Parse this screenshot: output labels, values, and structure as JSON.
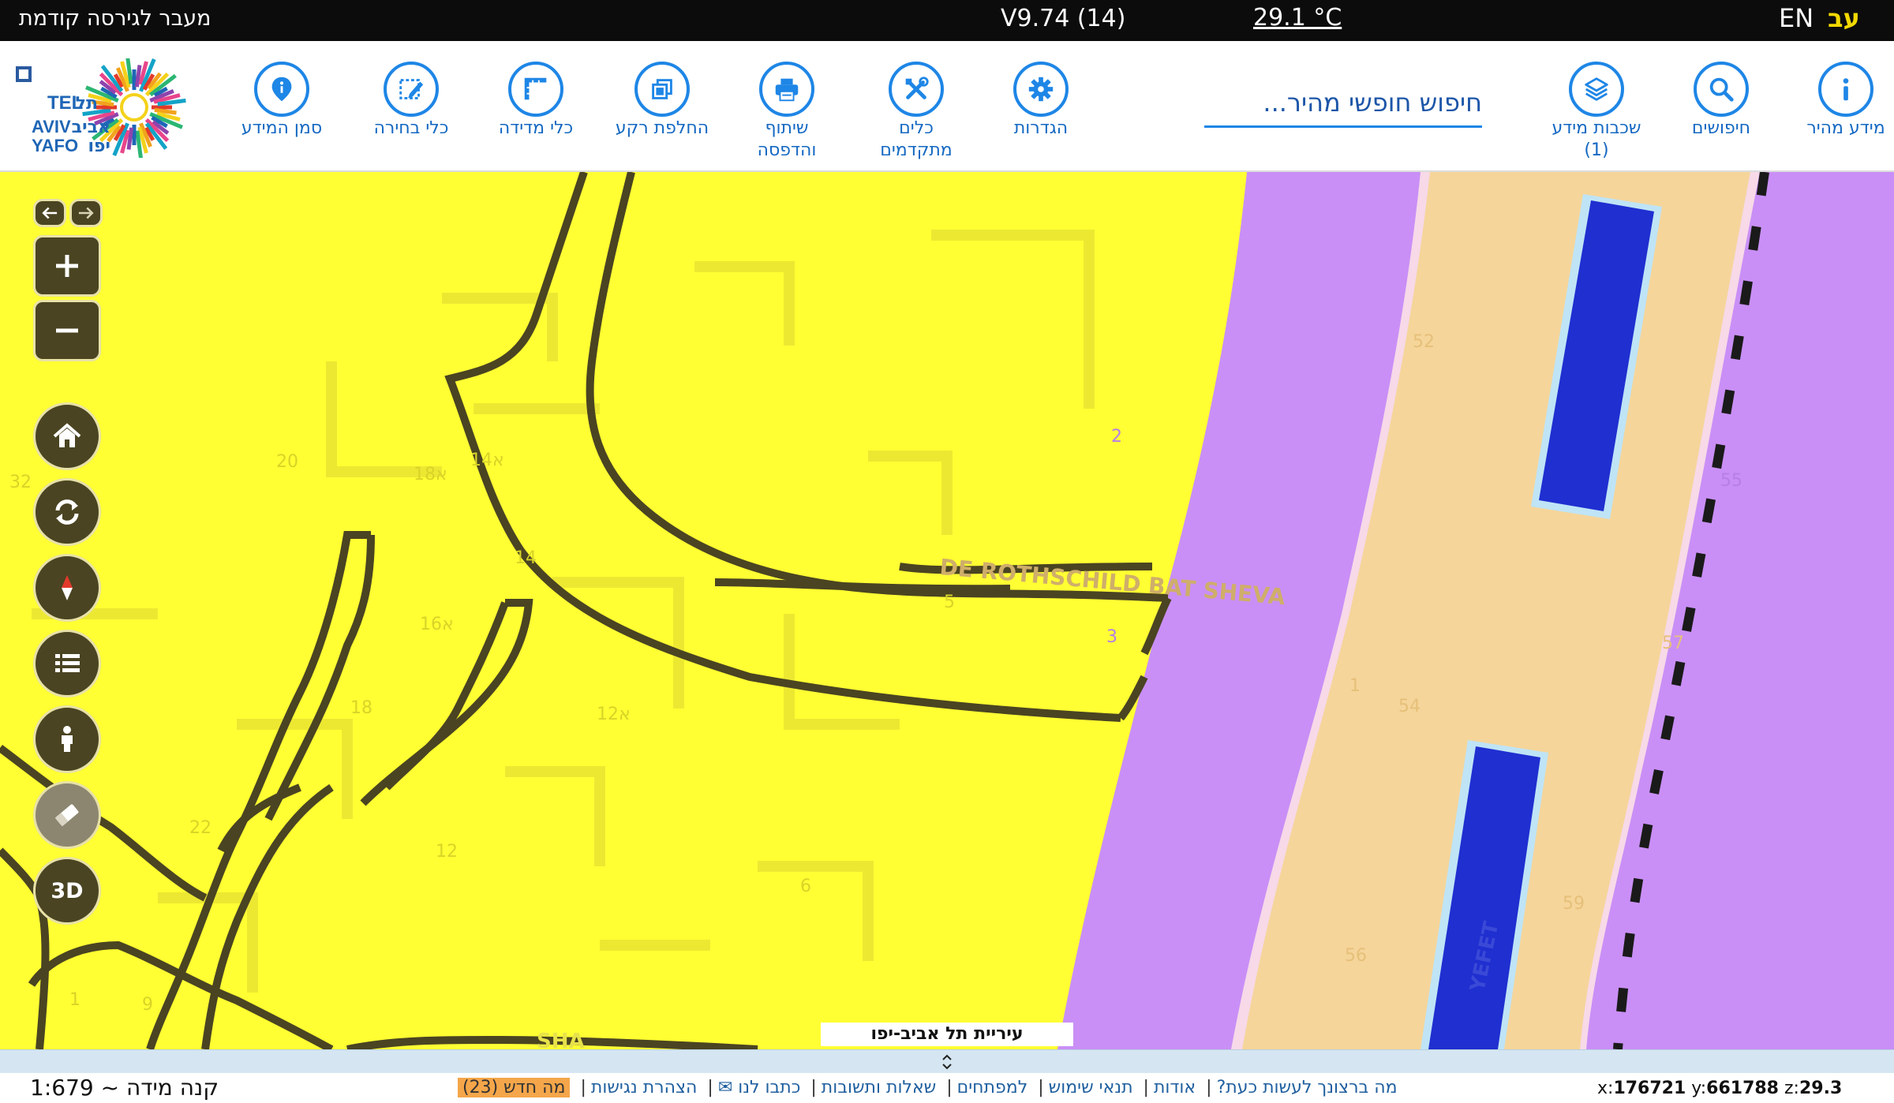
{
  "topbar": {
    "prev_version": "מעבר לגירסה קודמת",
    "version": "V9.74 (14)",
    "weather": "29.1 °C",
    "lang_en": "EN",
    "lang_he": "עב"
  },
  "logo": {
    "text_en": "TEL AVIV YAFO",
    "text_he": "תל אביב יפו"
  },
  "toolbar": {
    "quick_info": "מידע מהיר",
    "searches": "חיפושים",
    "layers": "שכבות מידע",
    "layers_count": "(1)",
    "search_placeholder": "חיפוש חופשי מהיר...",
    "settings": "הגדרות",
    "advanced_tools_1": "כלים",
    "advanced_tools_2": "מתקדמים",
    "share_print_1": "שיתוף",
    "share_print_2": "והדפסה",
    "basemap": "החלפת רקע",
    "measure": "כלי מדידה",
    "select": "כלי בחירה",
    "marker": "סמן המידע"
  },
  "map": {
    "attribution": "עיריית תל אביב-יפו",
    "street_label_1": "DE ROTHSCHILD BAT SHEVA",
    "street_label_2": "YEFET",
    "street_label_3": "SHA",
    "btn_3d": "3D",
    "house_numbers": [
      {
        "t": "52"
      },
      {
        "t": "2"
      },
      {
        "t": "55"
      },
      {
        "t": "20"
      },
      {
        "t": "18א"
      },
      {
        "t": "14א"
      },
      {
        "t": "32"
      },
      {
        "t": "14"
      },
      {
        "t": "16א"
      },
      {
        "t": "5"
      },
      {
        "t": "3"
      },
      {
        "t": "57"
      },
      {
        "t": "1"
      },
      {
        "t": "54"
      },
      {
        "t": "18"
      },
      {
        "t": "12א"
      },
      {
        "t": "22"
      },
      {
        "t": "12"
      },
      {
        "t": "6"
      },
      {
        "t": "59"
      },
      {
        "t": "56"
      },
      {
        "t": "1"
      },
      {
        "t": "9"
      }
    ]
  },
  "status": {
    "coord_x_label": "x:",
    "coord_x": "176721",
    "coord_y_label": "y:",
    "coord_y": "661788",
    "coord_z_label": "z:",
    "coord_z": "29.3",
    "link_what_now": "מה ברצונך לעשות כעת?",
    "link_about": "אודות",
    "link_terms": "תנאי שימוש",
    "link_developers": "למפתחים",
    "link_faq": "שאלות ותשובות",
    "link_contact": "כתבו לנו ✉",
    "link_accessibility": "הצהרת נגישות",
    "whats_new": "מה חדש (23)",
    "scale": "קנה מידה ~ 1:679"
  },
  "colors": {
    "map_yellow": "#ffff33",
    "map_purple": "#c78ef5",
    "map_peach": "#f5d59a",
    "map_blue": "#1f2fd0",
    "accent_blue": "#1e86e6",
    "control_bg": "#4a4422"
  }
}
